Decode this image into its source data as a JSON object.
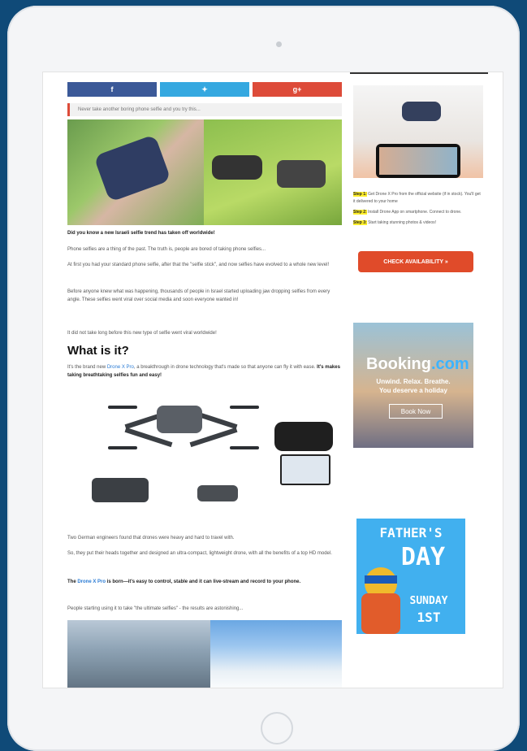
{
  "share": {
    "facebook": "f",
    "twitter": "✦",
    "google": "g+"
  },
  "quote": "Never take another boring phone selfie and you try this...",
  "article": {
    "headline": "Did you know a new Israeli selfie trend has taken off worldwide!",
    "p1": "Phone selfies are a thing of the past. The truth is, people are bored of taking phone selfies...",
    "p2": "At first you had your standard phone selfie, after that the \"selfie stick\", and now selfies have evolved to a whole new level!",
    "p3": "Before anyone knew what was happening, thousands of people in Israel started uploading jaw dropping selfies from every angle. These selfies went viral over social media and soon everyone wanted in!",
    "p4": "It did not take long before this new type of selfie went viral worldwide!",
    "h2": "What is it?",
    "p5_pre": "It's the brand new ",
    "p5_link": "Drone X Pro",
    "p5_post": ", a breakthrough in drone technology that's made so that anyone can fly it with ease. ",
    "p5_bold": "It's makes taking breathtaking selfies fun and easy!",
    "p6": "Two German engineers found that drones were heavy and hard to travel with.",
    "p7": "So, they put their heads together and designed an ultra-compact, lightweight drone, with all the benefits of a top HD model.",
    "p8_pre": "The ",
    "p8_link": "Drone X Pro",
    "p8_post": " is born—it's easy to control, stable and it can live-stream and record to your phone.",
    "p9": "People starting using it to take \"the ultimate selfies\" - the results are astonishing..."
  },
  "sidebar": {
    "step1_label": "Step 1:",
    "step1_text": "Get Drone X Pro from the official website (if in stock). You'll get it delivered to your home",
    "step2_label": "Step 2:",
    "step2_text": "Install Drone App on smartphone. Connect to drone.",
    "step3_label": "Step 3:",
    "step3_text": "Start taking stunning photos & videos!",
    "cta": "CHECK AVAILABILITY »",
    "booking_logo_a": "Booking",
    "booking_logo_b": ".com",
    "booking_tag1": "Unwind. Relax. Breathe.",
    "booking_tag2": "You deserve a holiday",
    "booking_btn": "Book Now",
    "fathers_1": "FATHER'S",
    "fathers_2": "DAY",
    "fathers_3": "SUNDAY",
    "fathers_4": "1ST"
  }
}
